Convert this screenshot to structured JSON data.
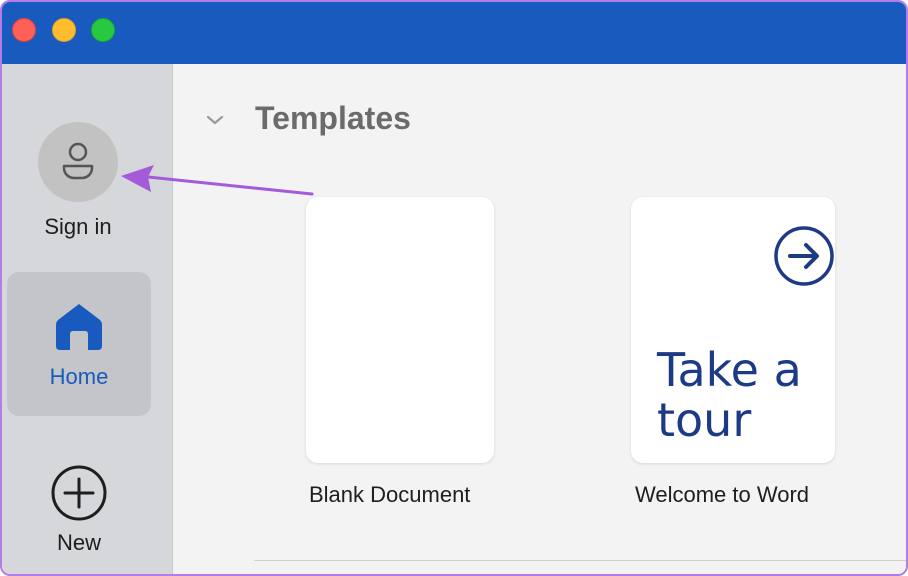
{
  "window": {
    "close_button": "close",
    "minimize_button": "minimize",
    "zoom_button": "zoom"
  },
  "sidebar": {
    "signin_label": "Sign in",
    "home_label": "Home",
    "new_label": "New",
    "accent_color": "#185abd"
  },
  "main": {
    "section_title": "Templates",
    "templates": [
      {
        "caption": "Blank Document"
      },
      {
        "caption": "Welcome to Word",
        "thumbnail_text": "Take a tour"
      }
    ]
  },
  "colors": {
    "titlebar": "#185abd",
    "annotation_arrow": "#a35bd9"
  },
  "icons": {
    "avatar": "person-icon",
    "home": "home-icon",
    "new": "plus-circle-icon",
    "collapse": "chevron-down-icon",
    "tour": "arrow-right-circle-icon"
  }
}
